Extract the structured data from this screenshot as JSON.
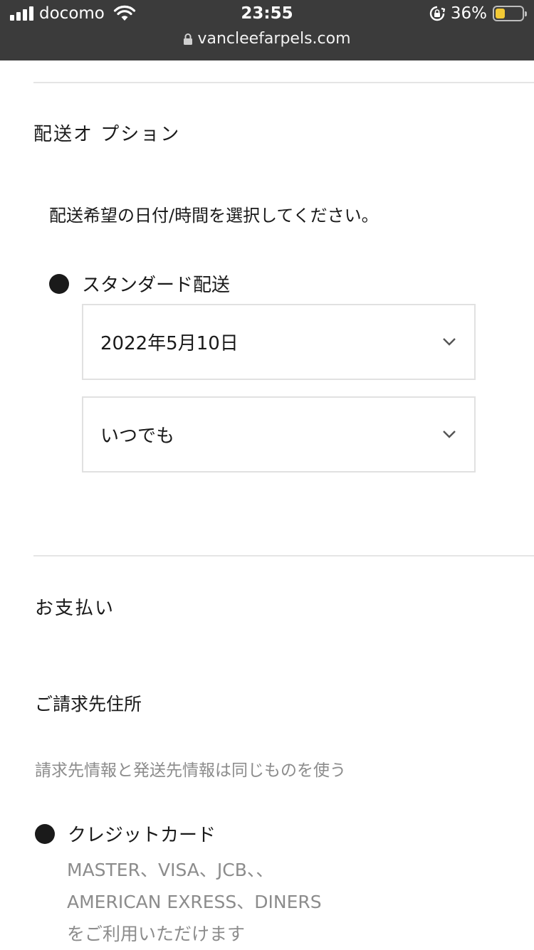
{
  "status_bar": {
    "carrier": "docomo",
    "time": "23:55",
    "battery": "36%",
    "battery_level": 0.36,
    "url": "vancleefarpels.com",
    "icons": [
      "signal-icon",
      "wifi-icon",
      "rotation-lock-icon",
      "battery-icon",
      "padlock-icon"
    ]
  },
  "shipping": {
    "title": "配送オ プション",
    "instruction": "配送希望の日付/時間を選択してください。",
    "method_label": "スタンダード配送",
    "date_value": "2022年5月10日",
    "time_value": "いつでも"
  },
  "payment": {
    "title": "お支払い",
    "billing_label": "ご請求先住所",
    "billing_note": "請求先情報と発送先情報は同じものを使う",
    "method_label": "クレジットカード",
    "cards_line1": "MASTER、VISA、JCB、、",
    "cards_line2": "AMERICAN EXRESS、DINERS",
    "cards_line3": "をご利用いただけます"
  }
}
